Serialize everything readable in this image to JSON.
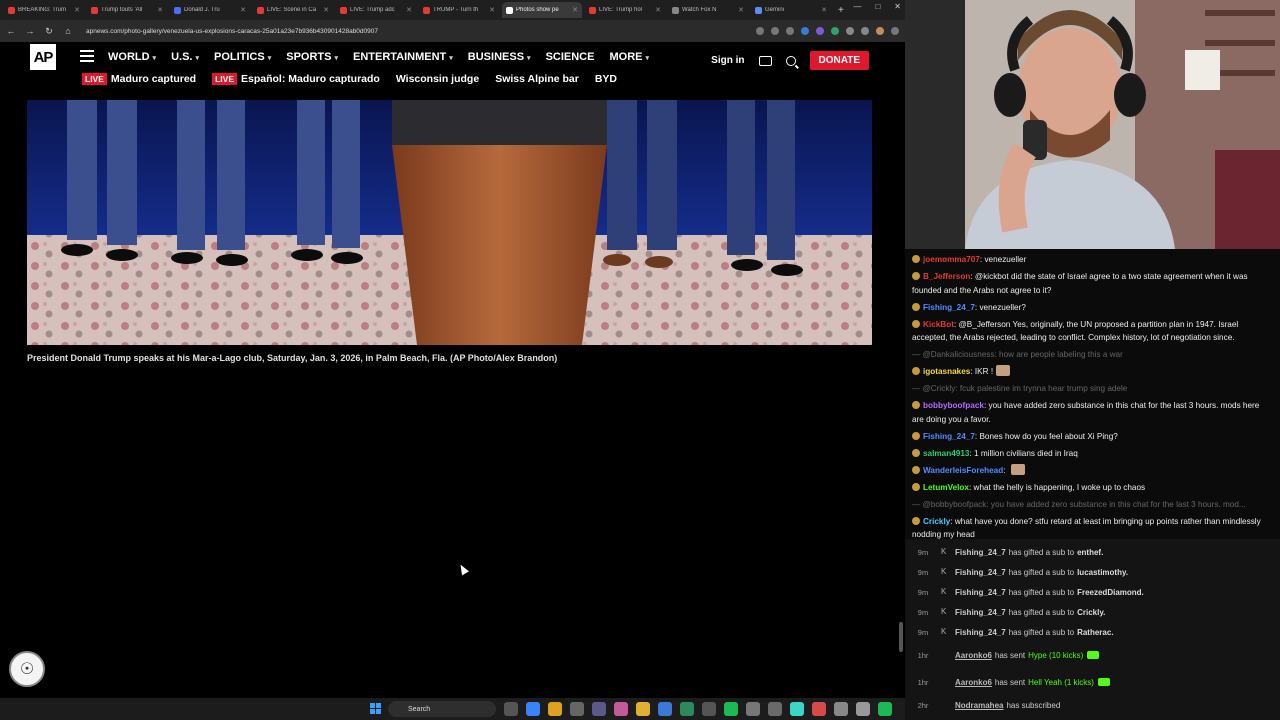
{
  "browser": {
    "tabs": [
      {
        "label": "BREAKING: Trum",
        "color": "#e53935",
        "active": false
      },
      {
        "label": "Trump touts 'All",
        "color": "#e53935",
        "active": false
      },
      {
        "label": "Donald J. Tru",
        "color": "#4a6cf7",
        "active": false
      },
      {
        "label": "LIVE: Scene in Ca",
        "color": "#e53935",
        "active": false
      },
      {
        "label": "LIVE: Trump adc",
        "color": "#e53935",
        "active": false
      },
      {
        "label": "TRUMP - Turn th",
        "color": "#e53935",
        "active": false
      },
      {
        "label": "Photos show pe",
        "color": "#ffffff",
        "active": true
      },
      {
        "label": "LIVE: Trump hol",
        "color": "#e53935",
        "active": false
      },
      {
        "label": "Watch Fox N",
        "color": "#888888",
        "active": false
      },
      {
        "label": "Gemini",
        "color": "#5b8def",
        "active": false
      }
    ],
    "url": "apnews.com/photo-gallery/venezuela-us-explosions-caracas-25a01a23e7b936b430901428ab0d0907"
  },
  "ap": {
    "logo": "AP",
    "nav": [
      {
        "label": "WORLD",
        "caret": true
      },
      {
        "label": "U.S.",
        "caret": true
      },
      {
        "label": "POLITICS",
        "caret": true
      },
      {
        "label": "SPORTS",
        "caret": true
      },
      {
        "label": "ENTERTAINMENT",
        "caret": true
      },
      {
        "label": "BUSINESS",
        "caret": true
      },
      {
        "label": "SCIENCE",
        "caret": false
      },
      {
        "label": "MORE",
        "caret": true
      }
    ],
    "signin": "Sign in",
    "donate": "DONATE",
    "trending": [
      {
        "live": true,
        "label": "Maduro captured"
      },
      {
        "live": true,
        "label": "Español: Maduro capturado"
      },
      {
        "live": false,
        "label": "Wisconsin judge"
      },
      {
        "live": false,
        "label": "Swiss Alpine bar"
      },
      {
        "live": false,
        "label": "BYD"
      }
    ],
    "live_tag": "LIVE",
    "caption": "President Donald Trump speaks at his Mar-a-Lago club, Saturday, Jan. 3, 2026, in Palm Beach, Fla. (AP Photo/Alex Brandon)"
  },
  "taskbar": {
    "search": "Search"
  },
  "chat": [
    {
      "user": "joemomma707",
      "color": "#e53935",
      "text": "venezueller",
      "muted": false
    },
    {
      "user": "B_Jefferson",
      "color": "#e53935",
      "text": "@kickbot did the state of Israel agree to a two state agreement when it was founded and the Arabs not agree to it?",
      "muted": false
    },
    {
      "user": "Fishing_24_7",
      "color": "#4f8cff",
      "text": "venezueller?",
      "muted": false
    },
    {
      "user": "KickBot",
      "color": "#e53935",
      "text": "@B_Jefferson Yes, originally, the UN proposed a partition plan in 1947. Israel accepted, the Arabs rejected, leading to conflict. Complex history, lot of negotiation since.",
      "muted": false
    },
    {
      "user": "",
      "color": "#666666",
      "text": "— @Dankaliciousness: how are people labeling this a war",
      "muted": true
    },
    {
      "user": "igotasnakes",
      "color": "#f5d742",
      "text": "IKR !",
      "muted": false
    },
    {
      "user": "",
      "color": "#666666",
      "text": "— @Crickly: fcuk palestine im trynna hear trump sing adele",
      "muted": true
    },
    {
      "user": "bobbyboofpack",
      "color": "#b36cff",
      "text": "you have added zero substance in this chat for the last 3 hours. mods here are doing you a favor.",
      "muted": false
    },
    {
      "user": "Fishing_24_7",
      "color": "#4f8cff",
      "text": "Bones how do you feel about Xi Ping?",
      "muted": false
    },
    {
      "user": "salman4913",
      "color": "#2ecc71",
      "text": "1 million civilians died in Iraq",
      "muted": false
    },
    {
      "user": "WanderleisForehead",
      "color": "#4f8cff",
      "text": "",
      "muted": false
    },
    {
      "user": "LetumVelox",
      "color": "#53fc18",
      "text": "what the helly is happening, I woke up to chaos",
      "muted": false
    },
    {
      "user": "",
      "color": "#666666",
      "text": "— @bobbyboofpack: you have added zero substance in this chat for the last 3 hours. mod...",
      "muted": true
    },
    {
      "user": "Crickly",
      "color": "#53c6ff",
      "text": "what have you done? stfu retard at least im bringing up points rather than mindlessly nodding my head",
      "muted": false
    }
  ],
  "events": [
    {
      "time": "9m",
      "user": "Fishing_24_7",
      "action": "has gifted a sub to",
      "target": "enthef.",
      "kicks": "",
      "link": false
    },
    {
      "time": "9m",
      "user": "Fishing_24_7",
      "action": "has gifted a sub to",
      "target": "lucastimothy.",
      "kicks": "",
      "link": false
    },
    {
      "time": "9m",
      "user": "Fishing_24_7",
      "action": "has gifted a sub to",
      "target": "FreezedDiamond.",
      "kicks": "",
      "link": false
    },
    {
      "time": "9m",
      "user": "Fishing_24_7",
      "action": "has gifted a sub to",
      "target": "Crickly.",
      "kicks": "",
      "link": false
    },
    {
      "time": "9m",
      "user": "Fishing_24_7",
      "action": "has gifted a sub to",
      "target": "Ratherac.",
      "kicks": "",
      "link": false
    },
    {
      "time": "1hr",
      "user": "Aaronko6",
      "action": "has sent",
      "target": "",
      "kicks": "Hype (10 kicks)",
      "link": true
    },
    {
      "time": "1hr",
      "user": "Aaronko6",
      "action": "has sent",
      "target": "",
      "kicks": "Hell Yeah (1 kicks)",
      "link": true
    },
    {
      "time": "2hr",
      "user": "Nodramahea",
      "action": "has subscribed",
      "target": "",
      "kicks": "",
      "link": true
    }
  ]
}
